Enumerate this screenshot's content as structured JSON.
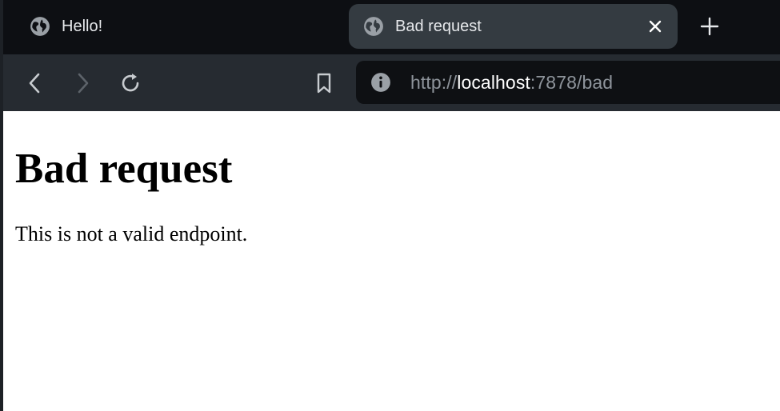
{
  "browser": {
    "tabs": [
      {
        "title": "Hello!",
        "icon": "globe-icon",
        "active": false
      },
      {
        "title": "Bad request",
        "icon": "globe-icon",
        "active": true
      }
    ],
    "address_bar": {
      "scheme": "http://",
      "host": "localhost",
      "rest": ":7878/bad",
      "site_info_icon": "info-icon"
    },
    "toolbar_icons": [
      "back-icon",
      "forward-icon",
      "reload-icon",
      "bookmark-icon"
    ]
  },
  "page": {
    "heading": "Bad request",
    "message": "This is not a valid endpoint."
  },
  "colors": {
    "tabstrip_bg": "#0d0f13",
    "active_tab_bg": "#343b41",
    "toolbar_bg": "#262b31",
    "urlbar_bg": "#0e1013",
    "url_dim": "#8e949b",
    "url_host": "#ffffff"
  }
}
